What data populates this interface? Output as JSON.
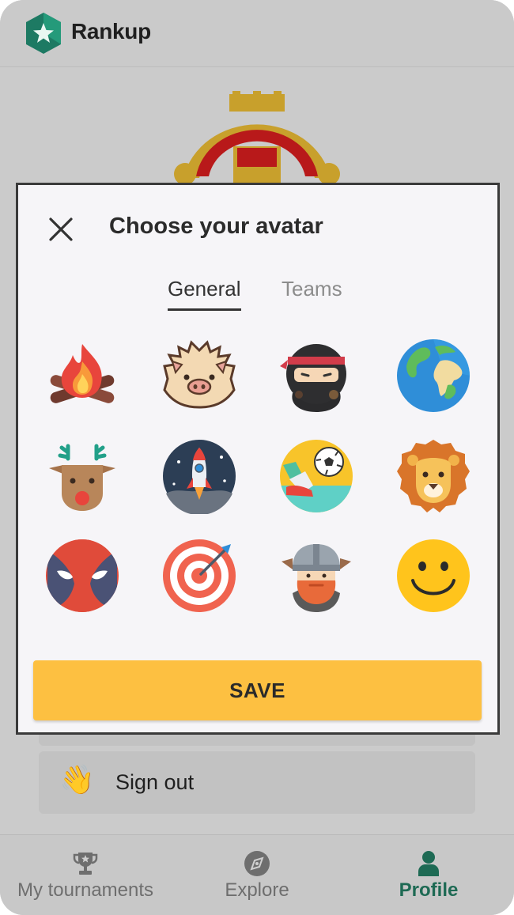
{
  "app": {
    "title": "Rankup"
  },
  "profile": {
    "signout_label": "Sign out",
    "signout_emoji": "👋"
  },
  "nav": {
    "items": [
      {
        "label": "My tournaments",
        "icon": "trophy-icon"
      },
      {
        "label": "Explore",
        "icon": "compass-icon"
      },
      {
        "label": "Profile",
        "icon": "person-icon",
        "active": true
      }
    ]
  },
  "modal": {
    "title": "Choose your avatar",
    "tabs": [
      {
        "label": "General",
        "selected": true
      },
      {
        "label": "Teams",
        "selected": false
      }
    ],
    "avatars": [
      "campfire",
      "pig",
      "ninja",
      "earth",
      "reindeer",
      "rocket",
      "football",
      "lion",
      "masked-hero",
      "target",
      "viking",
      "smiley"
    ],
    "save_label": "SAVE"
  },
  "colors": {
    "accent": "#fdc041",
    "brand_green": "#1e6a54",
    "overlay": "#cbcbcb"
  }
}
